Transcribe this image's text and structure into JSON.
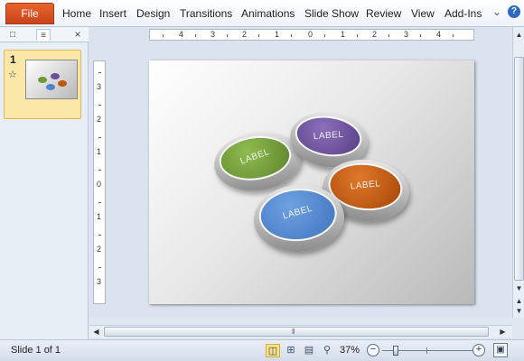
{
  "ribbon": {
    "file_label": "File",
    "tabs": [
      "Home",
      "Insert",
      "Design",
      "Transitions",
      "Animations",
      "Slide Show",
      "Review",
      "View",
      "Add-Ins"
    ],
    "icons": [
      "collapse-ribbon-icon",
      "help-icon"
    ]
  },
  "slides_panel": {
    "slides": [
      {
        "number": "1",
        "has_animation": true
      }
    ]
  },
  "rulers": {
    "horizontal": [
      "4",
      "3",
      "2",
      "1",
      "0",
      "1",
      "2",
      "3",
      "4"
    ],
    "vertical": [
      "3",
      "2",
      "1",
      "0",
      "1",
      "2",
      "3"
    ]
  },
  "slide": {
    "labels": [
      "LABEL",
      "LABEL",
      "LABEL",
      "LABEL"
    ],
    "colors": {
      "green": "#6f9a37",
      "purple": "#6b4f9a",
      "orange": "#c0560d",
      "blue": "#4d86cf"
    }
  },
  "status": {
    "slide_info": "Slide 1 of 1",
    "zoom": "37%",
    "zoom_level": 0.37
  },
  "theme": {
    "file_tab_color": "#d64f1f",
    "active_view_color": "#fbe08a"
  }
}
